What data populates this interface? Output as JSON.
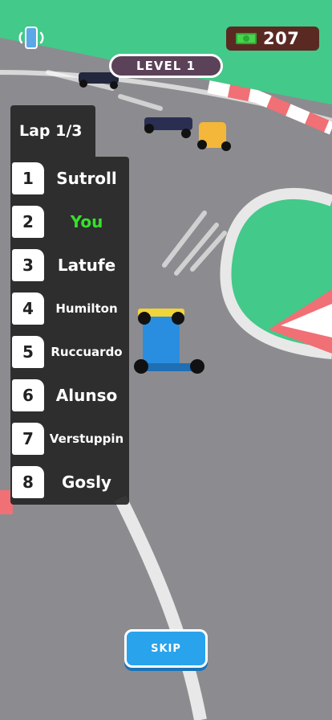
{
  "hud": {
    "cash_value": "207",
    "level_label": "LEVEL 1",
    "skip_label": "SKIP"
  },
  "standings": {
    "lap_label": "Lap 1/3",
    "rows": [
      {
        "pos": "1",
        "name": "Sutroll"
      },
      {
        "pos": "2",
        "name": "You"
      },
      {
        "pos": "3",
        "name": "Latufe"
      },
      {
        "pos": "4",
        "name": "Humilton"
      },
      {
        "pos": "5",
        "name": "Ruccuardo"
      },
      {
        "pos": "6",
        "name": "Alunso"
      },
      {
        "pos": "7",
        "name": "Verstuppin"
      },
      {
        "pos": "8",
        "name": "Gosly"
      }
    ]
  },
  "colors": {
    "grass": "#43c98a",
    "track": "#8c8c90",
    "curb_red": "#f07075",
    "you_highlight": "#37e02c",
    "skip_button": "#29a3ec",
    "cash_panel": "#5a2a22",
    "level_pill": "#5b4258"
  },
  "icons": {
    "vibrate": "phone-vibrate-icon",
    "cash": "cash-icon"
  }
}
